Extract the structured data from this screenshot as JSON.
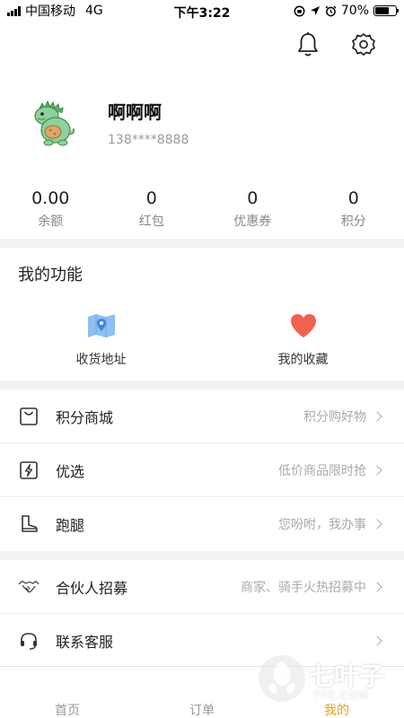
{
  "status_bar": {
    "carrier": "中国移动",
    "network": "4G",
    "time": "下午3:22",
    "battery": "70%",
    "battery_level": 0.7
  },
  "header": {
    "bell_icon": "bell-icon",
    "settings_icon": "gear-icon"
  },
  "profile": {
    "name": "啊啊啊",
    "phone": "138****8888",
    "avatar_icon": "dinosaur-avatar"
  },
  "stats": [
    {
      "value": "0.00",
      "label": "余额"
    },
    {
      "value": "0",
      "label": "红包"
    },
    {
      "value": "0",
      "label": "优惠券"
    },
    {
      "value": "0",
      "label": "积分"
    }
  ],
  "functions": {
    "title": "我的功能",
    "items": [
      {
        "label": "收货地址",
        "icon": "map-icon",
        "color": "#6aa7e8"
      },
      {
        "label": "我的收藏",
        "icon": "heart-icon",
        "color": "#f0624f"
      }
    ]
  },
  "menu_group_1": [
    {
      "label": "积分商城",
      "hint": "积分购好物",
      "icon": "shopping-bag-icon"
    },
    {
      "label": "优选",
      "hint": "低价商品限时抢",
      "icon": "lightning-icon"
    },
    {
      "label": "跑腿",
      "hint": "您吩咐，我办事",
      "icon": "boot-icon"
    }
  ],
  "menu_group_2": [
    {
      "label": "合伙人招募",
      "hint": "商家、骑手火热招募中",
      "icon": "handshake-icon"
    },
    {
      "label": "联系客服",
      "hint": "",
      "icon": "headset-icon"
    }
  ],
  "tabs": [
    {
      "label": "首页",
      "active": false
    },
    {
      "label": "订单",
      "active": false
    },
    {
      "label": "我的",
      "active": true
    }
  ],
  "watermark": {
    "text": "七叶子",
    "sub": "7YZ.COM"
  },
  "colors": {
    "accent": "#e8a21d",
    "divider": "#f2f2f2"
  }
}
